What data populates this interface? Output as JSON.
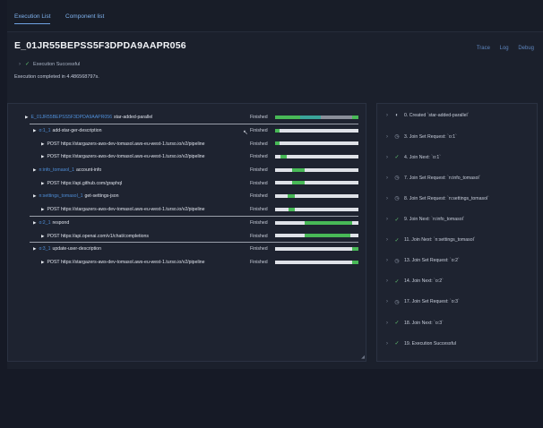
{
  "nav": {
    "tabs": [
      "Execution List",
      "Component list"
    ]
  },
  "header": {
    "title": "E_01JR55BEPSS5F3DPDA9AAPR056",
    "links": [
      "Trace",
      "Log",
      "Debug"
    ],
    "status": "Execution Successful",
    "completed": "Execution completed in 4.486568797s."
  },
  "tree": {
    "rows": [
      {
        "indent": 0,
        "prefix": "E_01JR55BEPSS5F3DPDA9AAPR056",
        "label": "star-added-parallel",
        "status": "Finished",
        "bar": {
          "start": 0.0,
          "end": 1.0
        }
      },
      {
        "indent": 1,
        "prefix": "o:1_1",
        "label": "add-star-ger-description",
        "status": "Finished",
        "bar": {
          "start": 0.0,
          "end": 0.05
        }
      },
      {
        "indent": 2,
        "prefix": "",
        "label": "POST https://stargazers-aws-dev-tomasol.aws-eu-west-1.turso.io/v2/pipeline",
        "status": "Finished",
        "bar": {
          "start": 0.0,
          "end": 0.05
        }
      },
      {
        "indent": 2,
        "prefix": "",
        "label": "POST https://stargazers-aws-dev-tomasol.aws-eu-west-1.turso.io/v2/pipeline",
        "status": "Finished",
        "bar": {
          "start": 0.06,
          "end": 0.14
        }
      },
      {
        "indent": 1,
        "prefix": "n:info_tomasol_1",
        "label": "account-info",
        "status": "Finished",
        "bar": {
          "start": 0.2,
          "end": 0.36
        }
      },
      {
        "indent": 2,
        "prefix": "",
        "label": "POST https://api.github.com/graphql",
        "status": "Finished",
        "bar": {
          "start": 0.2,
          "end": 0.36
        }
      },
      {
        "indent": 1,
        "prefix": "n:settings_tomasol_1",
        "label": "get-settings-json",
        "status": "Finished",
        "bar": {
          "start": 0.15,
          "end": 0.24
        }
      },
      {
        "indent": 2,
        "prefix": "",
        "label": "POST https://stargazers-aws-dev-tomasol.aws-eu-west-1.turso.io/v2/pipeline",
        "status": "Finished",
        "bar": {
          "start": 0.16,
          "end": 0.24
        }
      },
      {
        "indent": 1,
        "prefix": "o:2_1",
        "label": "respond",
        "status": "Finished",
        "bar": {
          "start": 0.36,
          "end": 0.92
        }
      },
      {
        "indent": 2,
        "prefix": "",
        "label": "POST https://api.openai.com/v1/chat/completions",
        "status": "Finished",
        "bar": {
          "start": 0.36,
          "end": 0.9
        }
      },
      {
        "indent": 1,
        "prefix": "o:3_1",
        "label": "update-user-description",
        "status": "Finished",
        "bar": {
          "start": 0.92,
          "end": 1.0
        }
      },
      {
        "indent": 2,
        "prefix": "",
        "label": "POST https://stargazers-aws-dev-tomasol.aws-eu-west-1.turso.io/v2/pipeline",
        "status": "Finished",
        "bar": {
          "start": 0.92,
          "end": 1.0
        }
      }
    ]
  },
  "events": [
    {
      "icon": "created",
      "label": "0. Created `star-added-parallel`"
    },
    {
      "icon": "clock",
      "label": "3. Join Set Request: `o:1`"
    },
    {
      "icon": "check",
      "label": "4. Join Next: `o:1`"
    },
    {
      "icon": "clock",
      "label": "7. Join Set Request: `n:info_tomasol`"
    },
    {
      "icon": "clock",
      "label": "8. Join Set Request: `n:settings_tomasol`"
    },
    {
      "icon": "check",
      "label": "9. Join Next: `n:info_tomasol`"
    },
    {
      "icon": "check",
      "label": "11. Join Next: `n:settings_tomasol`"
    },
    {
      "icon": "clock",
      "label": "13. Join Set Request: `o:2`"
    },
    {
      "icon": "check",
      "label": "14. Join Next: `o:2`"
    },
    {
      "icon": "clock",
      "label": "17. Join Set Request: `o:3`"
    },
    {
      "icon": "check",
      "label": "18. Join Next: `o:3`"
    },
    {
      "icon": "check",
      "label": "19. Execution Successful"
    }
  ],
  "colors": {
    "accent": "#4f8fd9",
    "success": "#48b957",
    "bar_bg": "#dfe2e8",
    "first_bar_pattern": [
      "#48b957",
      "#3aa59a",
      "#8a8f9a",
      "#48b957"
    ]
  }
}
